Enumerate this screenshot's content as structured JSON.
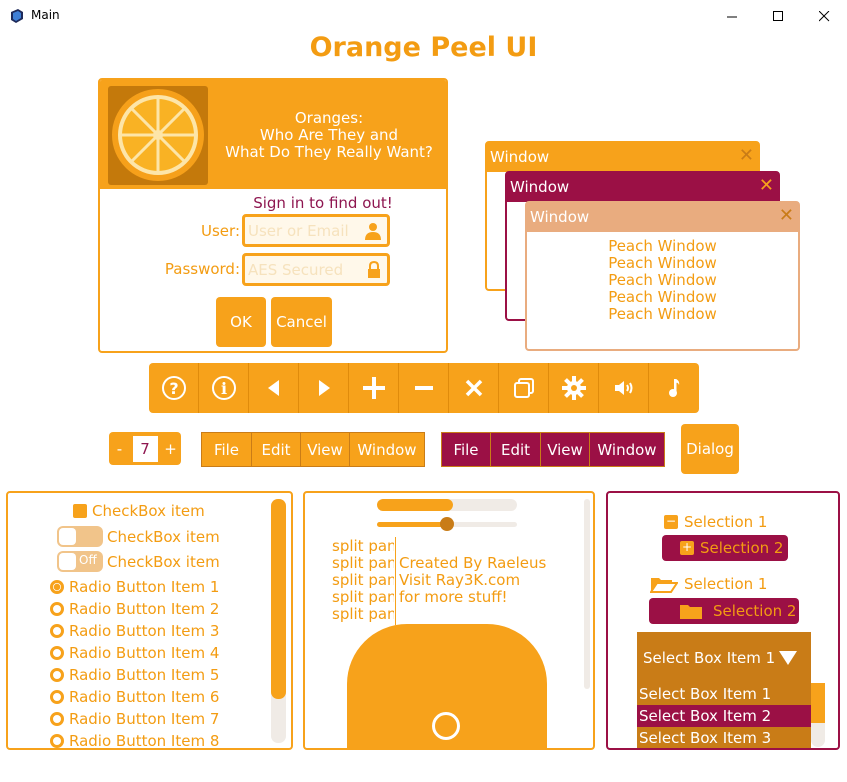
{
  "window": {
    "title": "Main"
  },
  "app": {
    "heading": "Orange Peel UI"
  },
  "login": {
    "headline": "Oranges:\nWho Are They and\nWhat Do They Really Want?",
    "signin": "Sign in to find out!",
    "user_label": "User:",
    "user_placeholder": "User or Email",
    "password_label": "Password:",
    "password_placeholder": "AES Secured",
    "ok": "OK",
    "cancel": "Cancel"
  },
  "windows": {
    "orange_title": "Window",
    "plum_title": "Window",
    "peach_title": "Window",
    "peach_lines": [
      "Peach Window",
      "Peach Window",
      "Peach Window",
      "Peach Window",
      "Peach Window"
    ]
  },
  "toolbar": {
    "icons": [
      "help-icon",
      "info-icon",
      "left-arrow-icon",
      "right-arrow-icon",
      "plus-icon",
      "minus-icon",
      "close-icon",
      "restore-icon",
      "gear-icon",
      "speaker-icon",
      "music-icon"
    ]
  },
  "spinner": {
    "minus": "-",
    "value": "7",
    "plus": "+"
  },
  "menu_orange": [
    "File",
    "Edit",
    "View",
    "Window"
  ],
  "menu_plum": [
    "File",
    "Edit",
    "View",
    "Window"
  ],
  "dialog_button": "Dialog",
  "checkboxes": {
    "items": [
      "CheckBox item",
      "CheckBox item",
      "CheckBox item"
    ],
    "toggle_off": "Off"
  },
  "radios": {
    "items": [
      "Radio Button Item 1",
      "Radio Button Item 2",
      "Radio Button Item 3",
      "Radio Button Item 4",
      "Radio Button Item 5",
      "Radio Button Item 6",
      "Radio Button Item 7",
      "Radio Button Item 8"
    ],
    "selected_index": 0
  },
  "progress": {
    "value": 0.54
  },
  "slider": {
    "value": 0.5
  },
  "split": {
    "left_lines": [
      "split pan",
      "split pan",
      "split pan",
      "split pan",
      "split pan"
    ],
    "right_lines": [
      "Created By Raeleus",
      "Visit Ray3K.com",
      "for more stuff!"
    ]
  },
  "tree": {
    "nodes": [
      "Selection 1",
      "Selection 2",
      "Selection 1",
      "Selection 2"
    ]
  },
  "selectbox": {
    "selected": "Select Box Item 1",
    "items": [
      "Select Box Item 1",
      "Select Box Item 2",
      "Select Box Item 3"
    ],
    "highlighted_index": 1
  },
  "colors": {
    "orange": "#f7a21b",
    "orange_text": "#f39c12",
    "plum": "#9b1045",
    "peach": "#e9ac7f",
    "brown": "#c97c17"
  }
}
